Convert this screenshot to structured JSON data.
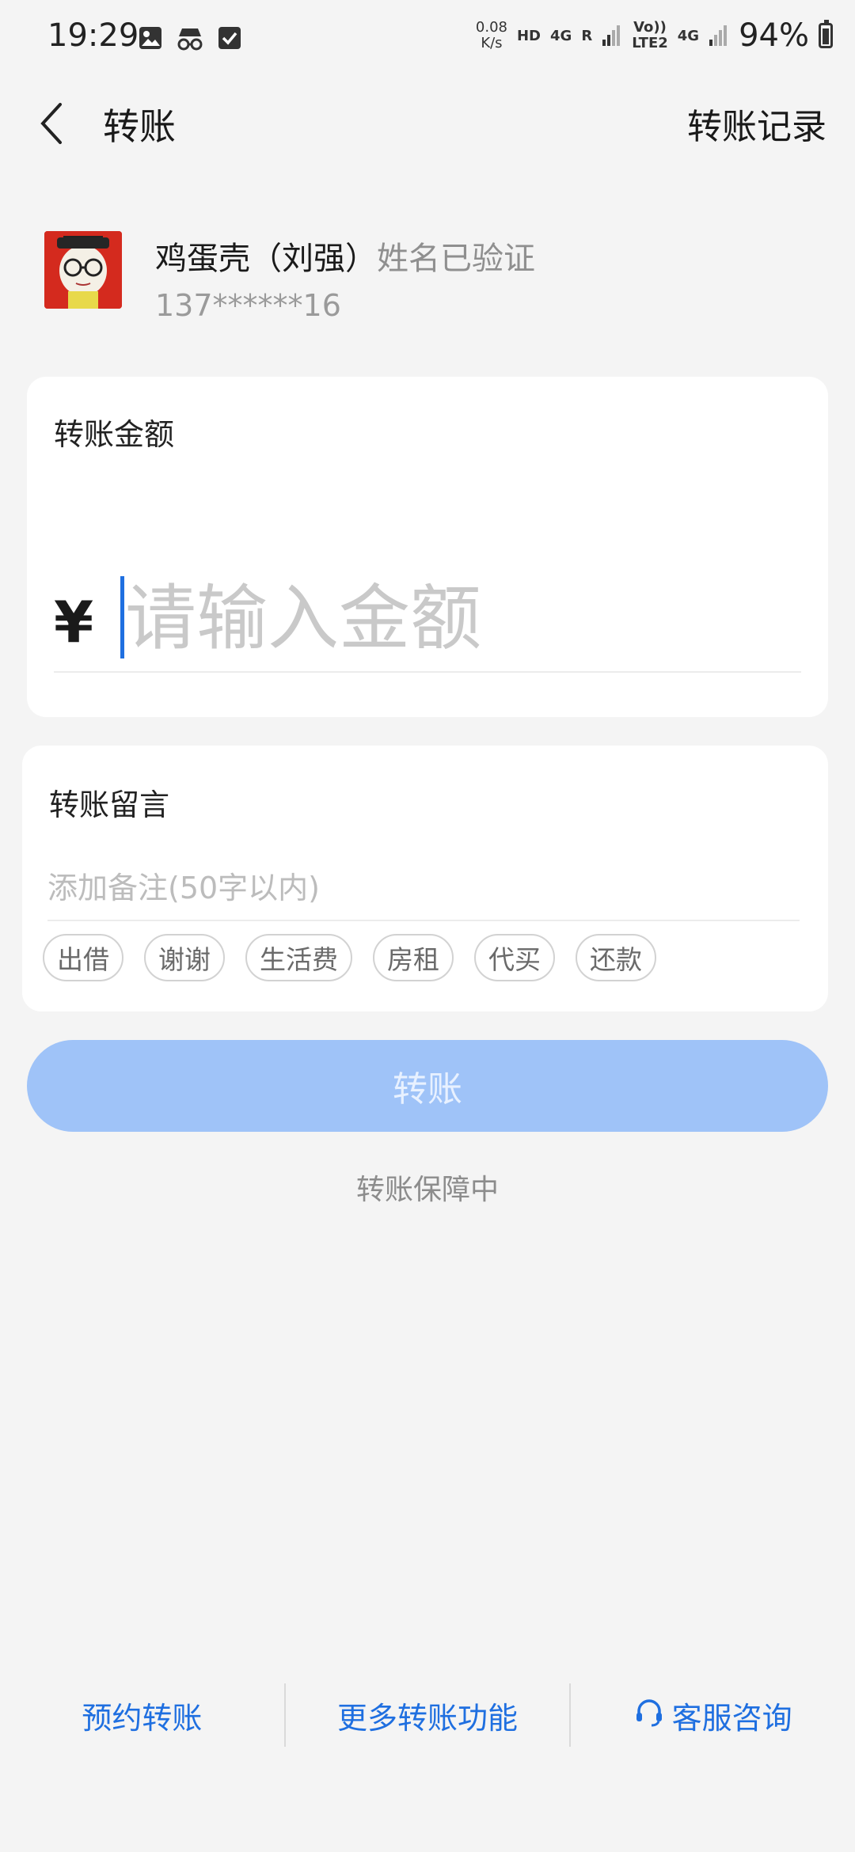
{
  "status_bar": {
    "time": "19:29",
    "net_speed_value": "0.08",
    "net_speed_unit": "K/s",
    "hd": "HD",
    "net1": "4G",
    "roaming": "R",
    "volte": "Vo))",
    "lte2": "LTE2",
    "net2": "4G",
    "battery": "94%"
  },
  "header": {
    "title": "转账",
    "record_link": "转账记录"
  },
  "recipient": {
    "name": "鸡蛋壳（刘强）",
    "verified_label": "姓名已验证",
    "phone": "137******16"
  },
  "amount_card": {
    "label": "转账金额",
    "currency_symbol": "¥",
    "placeholder": "请输入金额",
    "value": ""
  },
  "message_card": {
    "label": "转账留言",
    "placeholder": "添加备注(50字以内)",
    "chips": [
      "出借",
      "谢谢",
      "生活费",
      "房租",
      "代买",
      "还款"
    ]
  },
  "transfer_button": "转账",
  "guarantee_text": "转账保障中",
  "footer": {
    "scheduled": "预约转账",
    "more": "更多转账功能",
    "service": "客服咨询"
  },
  "colors": {
    "accent": "#1f6fe0",
    "button_disabled": "#9fc3f8",
    "background": "#f4f4f4"
  }
}
